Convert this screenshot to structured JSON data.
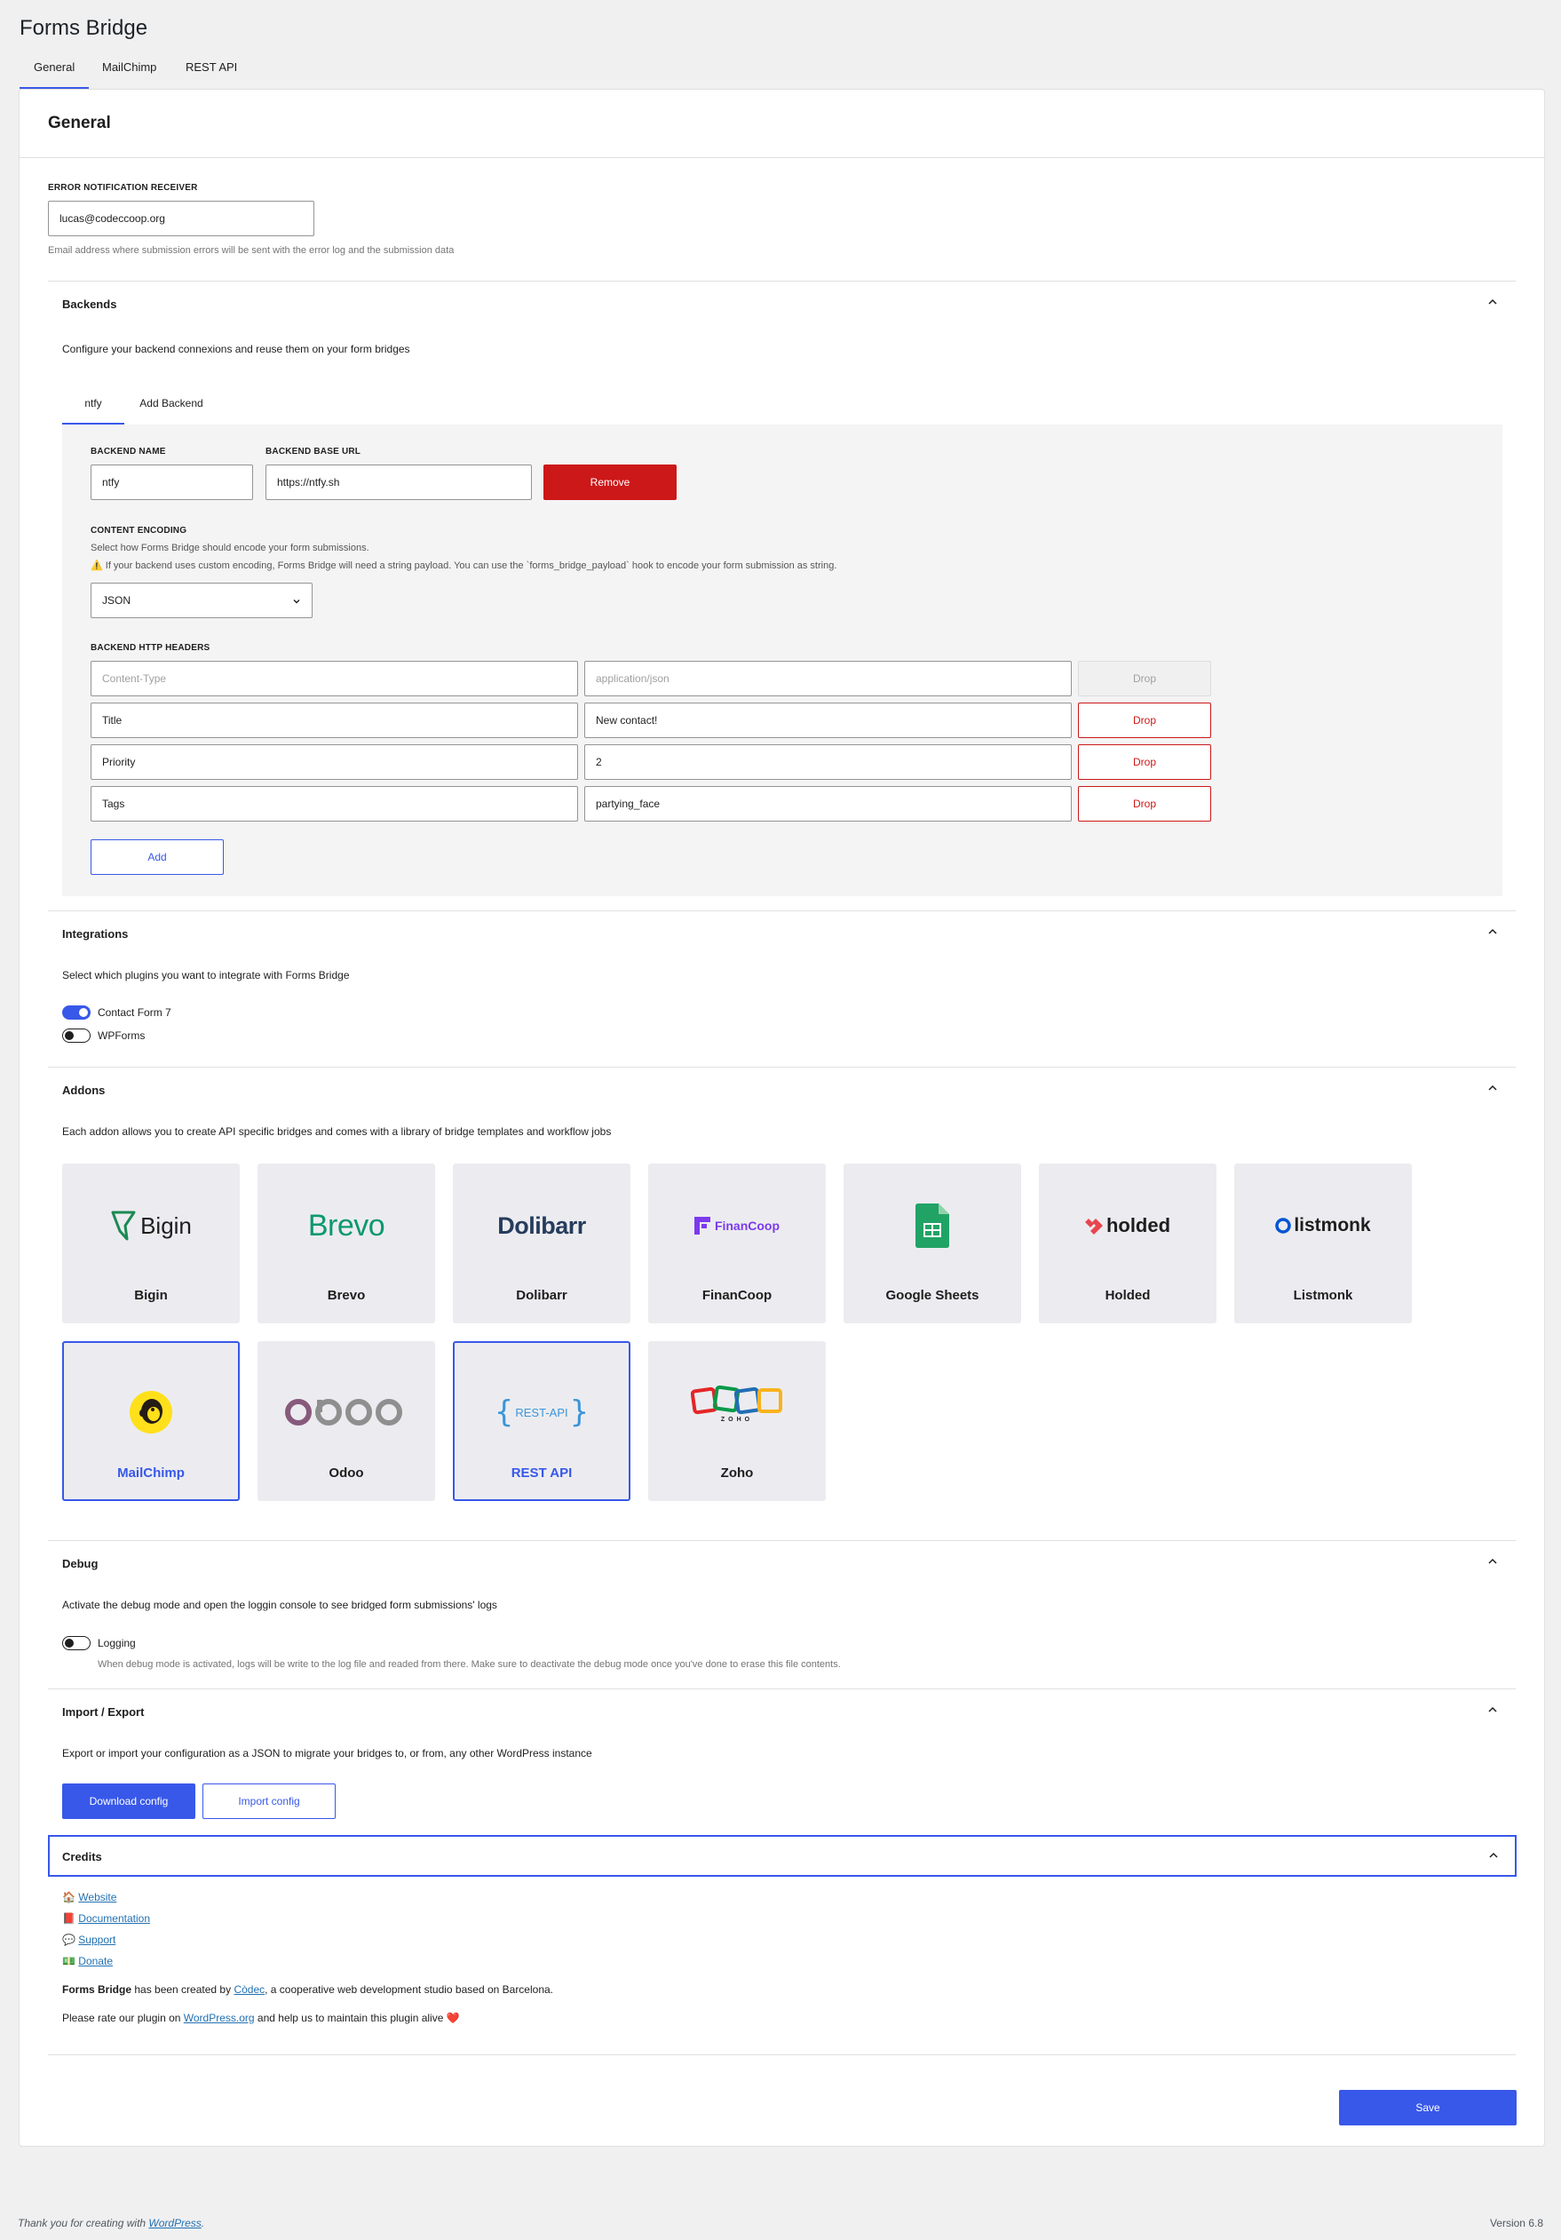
{
  "app": {
    "title": "Forms Bridge"
  },
  "tabs": [
    "General",
    "MailChimp",
    "REST API"
  ],
  "panel": {
    "title": "General"
  },
  "error_receiver": {
    "label": "ERROR NOTIFICATION RECEIVER",
    "value": "lucas@codeccoop.org",
    "help": "Email address where submission errors will be sent with the error log and the submission data"
  },
  "backends": {
    "title": "Backends",
    "description": "Configure your backend connexions and reuse them on your form bridges",
    "tabs": [
      "ntfy",
      "Add Backend"
    ],
    "name_label": "BACKEND NAME",
    "name_value": "ntfy",
    "url_label": "BACKEND BASE URL",
    "url_value": "https://ntfy.sh",
    "remove_label": "Remove",
    "encoding_label": "CONTENT ENCODING",
    "encoding_help": "Select how Forms Bridge should encode your form submissions.",
    "encoding_warning": "If your backend uses custom encoding, Forms Bridge will need a string payload. You can use the `forms_bridge_payload` hook to encode your form submission as string.",
    "encoding_value": "JSON",
    "headers_label": "BACKEND HTTP HEADERS",
    "headers": [
      {
        "name": "Content-Type",
        "value": "application/json",
        "drop": "Drop"
      },
      {
        "name": "Title",
        "value": "New contact!",
        "drop": "Drop"
      },
      {
        "name": "Priority",
        "value": "2",
        "drop": "Drop"
      },
      {
        "name": "Tags",
        "value": "partying_face",
        "drop": "Drop"
      }
    ],
    "add_label": "Add"
  },
  "integrations": {
    "title": "Integrations",
    "description": "Select which plugins you want to integrate with Forms Bridge",
    "items": [
      {
        "label": "Contact Form 7",
        "enabled": true
      },
      {
        "label": "WPForms",
        "enabled": false
      }
    ]
  },
  "addons": {
    "title": "Addons",
    "description": "Each addon allows you to create API specific bridges and comes with a library of bridge templates and workflow jobs",
    "cards": [
      {
        "name": "Bigin",
        "logo_text": "Bigin",
        "icon": "bigin-logo"
      },
      {
        "name": "Brevo",
        "logo_text": "Brevo",
        "icon": "brevo-logo"
      },
      {
        "name": "Dolibarr",
        "logo_text": "Dolibarr",
        "icon": "dolibarr-logo"
      },
      {
        "name": "FinanCoop",
        "logo_text": "FinanCoop",
        "icon": "financoop-logo"
      },
      {
        "name": "Google Sheets",
        "logo_text": "",
        "icon": "google-sheets-logo"
      },
      {
        "name": "Holded",
        "logo_text": "holded",
        "icon": "holded-logo"
      },
      {
        "name": "Listmonk",
        "logo_text": "listmonk",
        "icon": "listmonk-logo"
      },
      {
        "name": "MailChimp",
        "logo_text": "",
        "icon": "mailchimp-logo",
        "selected": true
      },
      {
        "name": "Odoo",
        "logo_text": "odoo",
        "icon": "odoo-logo"
      },
      {
        "name": "REST API",
        "logo_text": "REST-API",
        "icon": "rest-api-logo",
        "selected": true
      },
      {
        "name": "Zoho",
        "logo_text": "ZOHO",
        "icon": "zoho-logo"
      }
    ]
  },
  "debug": {
    "title": "Debug",
    "description": "Activate the debug mode and open the loggin console to see bridged form submissions' logs",
    "toggle_label": "Logging",
    "toggle_enabled": false,
    "help": "When debug mode is activated, logs will be write to the log file and readed from there. Make sure to deactivate the debug mode once you've done to erase this file contents."
  },
  "import_export": {
    "title": "Import / Export",
    "description": "Export or import your configuration as a JSON to migrate your bridges to, or from, any other WordPress instance",
    "download_label": "Download config",
    "import_label": "Import config"
  },
  "credits": {
    "title": "Credits",
    "links": [
      {
        "emoji": "🏠",
        "label": "Website"
      },
      {
        "emoji": "📕",
        "label": "Documentation"
      },
      {
        "emoji": "💬",
        "label": "Support"
      },
      {
        "emoji": "💵",
        "label": "Donate"
      }
    ],
    "created_by_bold": "Forms Bridge",
    "created_by_pre": " has been created by ",
    "created_by_link": "Còdec",
    "created_by_post": ", a cooperative web development studio based on Barcelona.",
    "rate_pre": "Please rate our plugin on ",
    "rate_link": "WordPress.org",
    "rate_post": " and help us to maintain this plugin alive ",
    "rate_emoji": "❤️"
  },
  "save_label": "Save",
  "footer": {
    "thanks_pre": "Thank you for creating with ",
    "thanks_link": "WordPress",
    "thanks_post": ".",
    "version": "Version 6.8"
  },
  "colors": {
    "accent": "#3858e9",
    "danger": "#cc1818",
    "background": "#f0f0f1"
  }
}
